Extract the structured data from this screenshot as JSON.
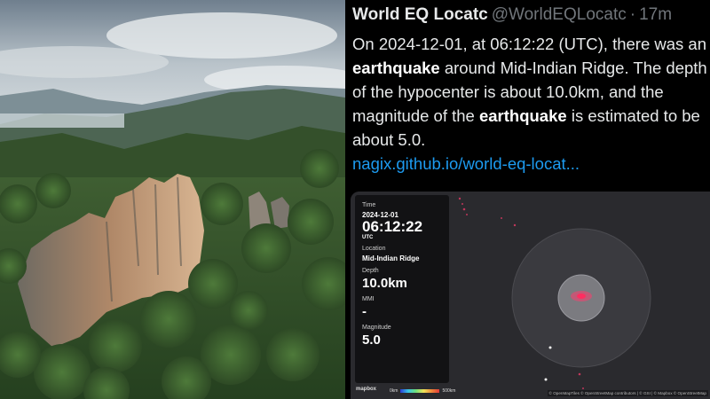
{
  "tweet": {
    "author_name": "World EQ Locatc",
    "author_handle": "@WorldEQLocatc",
    "separator": "·",
    "time_ago": "17m",
    "more_icon": "more-horizontal-icon",
    "body": {
      "p1": "On 2024-12-01, at 06:12:22 (UTC), there was an ",
      "k1": "earthquake",
      "p2": " around Mid-Indian Ridge. The depth of the hypocenter is about 10.0km, and the magnitude of the ",
      "k2": "earthquake",
      "p3": " is estimated to be about 5.0."
    },
    "link": "nagix.github.io/world-eq-locat..."
  },
  "card": {
    "time_label": "Time",
    "date": "2024-12-01",
    "time": "06:12:22",
    "timezone": "UTC",
    "location_label": "Location",
    "location": "Mid-Indian Ridge",
    "depth_label": "Depth",
    "depth": "10.0km",
    "mmi_label": "MMI",
    "mmi": "-",
    "magnitude_label": "Magnitude",
    "magnitude": "5.0",
    "mapbox_logo": "mapbox",
    "scale_min": "0km",
    "scale_max": "500km",
    "attribution": "© OpenMapTiles © OpenStreetMap contributors | © GSI | © Mapbox © OpenStreetMap"
  },
  "colors": {
    "tweet_bg": "#000000",
    "link": "#1d9bf0",
    "muted": "#71767b",
    "map_bg": "#2a2a2e",
    "epicenter": "#ff3d6e"
  },
  "photo": {
    "subject": "forested-rock-pinnacles-landscape"
  }
}
